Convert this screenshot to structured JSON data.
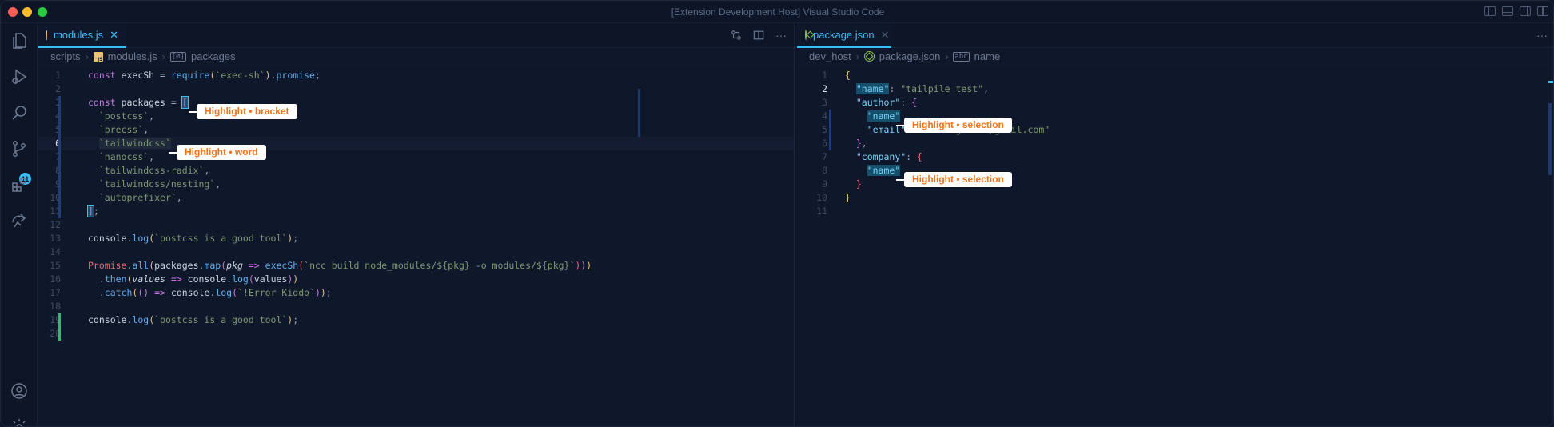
{
  "window": {
    "title": "[Extension Development Host] Visual Studio Code"
  },
  "activity_bar": {
    "items": [
      {
        "icon": "explorer-icon"
      },
      {
        "icon": "run-debug-icon"
      },
      {
        "icon": "search-icon"
      },
      {
        "icon": "source-control-icon",
        "badge": "11"
      },
      {
        "icon": "extensions-icon"
      },
      {
        "icon": "remote-icon"
      }
    ],
    "bottom": [
      {
        "icon": "account-icon"
      },
      {
        "icon": "settings-gear-icon"
      }
    ]
  },
  "left_editor": {
    "tab": {
      "label": "modules.js",
      "close": "✕"
    },
    "breadcrumb": [
      "scripts",
      "modules.js",
      "packages"
    ],
    "symbol_glyph": "[∅]",
    "lines": [
      {
        "n": "1",
        "code": [
          [
            "k",
            "const "
          ],
          [
            "v",
            "execSh "
          ],
          [
            "p",
            "= "
          ],
          [
            "f",
            "require"
          ],
          [
            "br1",
            "("
          ],
          [
            "s",
            "`exec-sh`"
          ],
          [
            "br1",
            ")"
          ],
          [
            "p",
            "."
          ],
          [
            "f",
            "promise"
          ],
          [
            "p",
            ";"
          ]
        ]
      },
      {
        "n": "2",
        "code": []
      },
      {
        "n": "3",
        "code": [
          [
            "k",
            "const "
          ],
          [
            "v",
            "packages "
          ],
          [
            "p",
            "= "
          ],
          [
            "br2",
            "["
          ]
        ]
      },
      {
        "n": "4",
        "code": [
          [
            "p",
            "  "
          ],
          [
            "s",
            "`postcss`"
          ],
          [
            "p",
            ","
          ]
        ]
      },
      {
        "n": "5",
        "code": [
          [
            "p",
            "  "
          ],
          [
            "s",
            "`precss`"
          ],
          [
            "p",
            ","
          ]
        ]
      },
      {
        "n": "6",
        "code": [
          [
            "p",
            "  "
          ],
          [
            "s",
            "`tailwindcss`"
          ]
        ]
      },
      {
        "n": "7",
        "code": [
          [
            "p",
            "  "
          ],
          [
            "s",
            "`nanocss`"
          ],
          [
            "p",
            ","
          ]
        ]
      },
      {
        "n": "8",
        "code": [
          [
            "p",
            "  "
          ],
          [
            "s",
            "`tailwindcss-radix`"
          ],
          [
            "p",
            ","
          ]
        ]
      },
      {
        "n": "9",
        "code": [
          [
            "p",
            "  "
          ],
          [
            "s",
            "`tailwindcss/nesting`"
          ],
          [
            "p",
            ","
          ]
        ]
      },
      {
        "n": "10",
        "code": [
          [
            "p",
            "  "
          ],
          [
            "s",
            "`autoprefixer`"
          ],
          [
            "p",
            ","
          ]
        ]
      },
      {
        "n": "11",
        "code": [
          [
            "br2",
            "]"
          ],
          [
            "p",
            ";"
          ]
        ]
      },
      {
        "n": "12",
        "code": []
      },
      {
        "n": "13",
        "code": [
          [
            "v",
            "console"
          ],
          [
            "p",
            "."
          ],
          [
            "f",
            "log"
          ],
          [
            "br1",
            "("
          ],
          [
            "s",
            "`postcss is a good tool`"
          ],
          [
            "br1",
            ")"
          ],
          [
            "p",
            ";"
          ]
        ]
      },
      {
        "n": "14",
        "code": []
      },
      {
        "n": "15",
        "code": [
          [
            "pk",
            "Promise"
          ],
          [
            "p",
            "."
          ],
          [
            "f",
            "all"
          ],
          [
            "br1",
            "("
          ],
          [
            "v",
            "packages"
          ],
          [
            "p",
            "."
          ],
          [
            "f",
            "map"
          ],
          [
            "br2",
            "("
          ],
          [
            "it",
            "pkg "
          ],
          [
            "ar",
            "=> "
          ],
          [
            "f",
            "execSh"
          ],
          [
            "br3",
            "("
          ],
          [
            "s",
            "`ncc build node_modules/${pkg} -o modules/${pkg}`"
          ],
          [
            "br3",
            ")"
          ],
          [
            "br2",
            ")"
          ],
          [
            "br1",
            ")"
          ]
        ]
      },
      {
        "n": "16",
        "code": [
          [
            "p",
            "  ."
          ],
          [
            "f",
            "then"
          ],
          [
            "br1",
            "("
          ],
          [
            "it",
            "values "
          ],
          [
            "ar",
            "=> "
          ],
          [
            "v",
            "console"
          ],
          [
            "p",
            "."
          ],
          [
            "f",
            "log"
          ],
          [
            "br2",
            "("
          ],
          [
            "v",
            "values"
          ],
          [
            "br2",
            ")"
          ],
          [
            "br1",
            ")"
          ]
        ]
      },
      {
        "n": "17",
        "code": [
          [
            "p",
            "  ."
          ],
          [
            "f",
            "catch"
          ],
          [
            "br1",
            "("
          ],
          [
            "br2",
            "()"
          ],
          [
            "ar",
            " => "
          ],
          [
            "v",
            "console"
          ],
          [
            "p",
            "."
          ],
          [
            "f",
            "log"
          ],
          [
            "br2",
            "("
          ],
          [
            "s",
            "`!Error Kiddo`"
          ],
          [
            "br2",
            ")"
          ],
          [
            "br1",
            ")"
          ],
          [
            "p",
            ";"
          ]
        ]
      },
      {
        "n": "18",
        "code": []
      },
      {
        "n": "19",
        "code": [
          [
            "v",
            "console"
          ],
          [
            "p",
            "."
          ],
          [
            "f",
            "log"
          ],
          [
            "br1",
            "("
          ],
          [
            "s",
            "`postcss is a good tool`"
          ],
          [
            "br1",
            ")"
          ],
          [
            "p",
            ";"
          ]
        ]
      },
      {
        "n": "20",
        "code": []
      }
    ],
    "callouts": {
      "bracket": "Highlight • bracket",
      "word": "Highlight • word"
    }
  },
  "right_editor": {
    "tab": {
      "label": "package.json",
      "close": "✕"
    },
    "breadcrumb": [
      "dev_host",
      "package.json",
      "name"
    ],
    "symbol_glyph": "abc",
    "lines": [
      {
        "n": "1",
        "code": [
          [
            "br1",
            "{"
          ]
        ]
      },
      {
        "n": "2",
        "code": [
          [
            "p",
            "  "
          ],
          [
            "jk",
            "\"name\""
          ],
          [
            "p",
            ": "
          ],
          [
            "js",
            "\"tailpile_test\""
          ],
          [
            "p",
            ","
          ]
        ]
      },
      {
        "n": "3",
        "code": [
          [
            "p",
            "  "
          ],
          [
            "jk",
            "\"author\""
          ],
          [
            "p",
            ": "
          ],
          [
            "br2",
            "{"
          ]
        ]
      },
      {
        "n": "4",
        "code": [
          [
            "p",
            "    "
          ],
          [
            "jk",
            "\"name\""
          ]
        ]
      },
      {
        "n": "5",
        "code": [
          [
            "p",
            "    "
          ],
          [
            "jk",
            "\"email\""
          ],
          [
            "p",
            ": "
          ],
          [
            "js",
            "\"sudoaugustin@gmail.com\""
          ]
        ]
      },
      {
        "n": "6",
        "code": [
          [
            "p",
            "  "
          ],
          [
            "br2",
            "}"
          ],
          [
            "p",
            ","
          ]
        ]
      },
      {
        "n": "7",
        "code": [
          [
            "p",
            "  "
          ],
          [
            "jk",
            "\"company\""
          ],
          [
            "p",
            ": "
          ],
          [
            "br3",
            "{"
          ]
        ]
      },
      {
        "n": "8",
        "code": [
          [
            "p",
            "    "
          ],
          [
            "jk",
            "\"name\""
          ]
        ]
      },
      {
        "n": "9",
        "code": [
          [
            "p",
            "  "
          ],
          [
            "br3",
            "}"
          ]
        ]
      },
      {
        "n": "10",
        "code": [
          [
            "br1",
            "}"
          ]
        ]
      },
      {
        "n": "11",
        "code": []
      }
    ],
    "callouts": {
      "selection_1": "Highlight • selection",
      "selection_2": "Highlight • selection"
    }
  },
  "toolbar": {
    "more_label": "···"
  },
  "colors": {
    "accent": "#38bdf8",
    "callout_text": "#f97316",
    "background": "#0f172a"
  }
}
